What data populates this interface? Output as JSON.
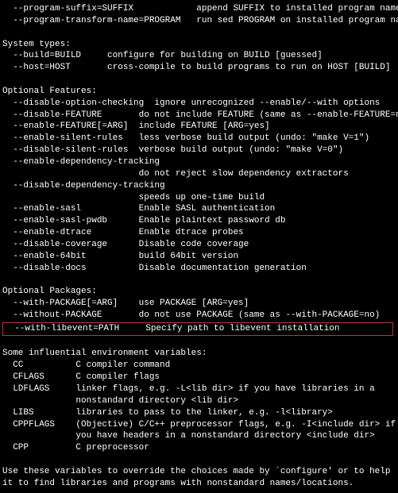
{
  "top": [
    "  --program-suffix=SUFFIX            append SUFFIX to installed program names",
    "  --program-transform-name=PROGRAM   run sed PROGRAM on installed program names"
  ],
  "system_types": {
    "header": "System types:",
    "lines": [
      "  --build=BUILD     configure for building on BUILD [guessed]",
      "  --host=HOST       cross-compile to build programs to run on HOST [BUILD]"
    ]
  },
  "optional_features": {
    "header": "Optional Features:",
    "lines": [
      "  --disable-option-checking  ignore unrecognized --enable/--with options",
      "  --disable-FEATURE       do not include FEATURE (same as --enable-FEATURE=no)",
      "  --enable-FEATURE[=ARG]  include FEATURE [ARG=yes]",
      "  --enable-silent-rules   less verbose build output (undo: \"make V=1\")",
      "  --disable-silent-rules  verbose build output (undo: \"make V=0\")",
      "  --enable-dependency-tracking",
      "                          do not reject slow dependency extractors",
      "  --disable-dependency-tracking",
      "                          speeds up one-time build",
      "  --enable-sasl           Enable SASL authentication",
      "  --enable-sasl-pwdb      Enable plaintext password db",
      "  --enable-dtrace         Enable dtrace probes",
      "  --disable-coverage      Disable code coverage",
      "  --enable-64bit          build 64bit version",
      "  --disable-docs          Disable documentation generation"
    ]
  },
  "optional_packages": {
    "header": "Optional Packages:",
    "lines": [
      "  --with-PACKAGE[=ARG]    use PACKAGE [ARG=yes]",
      "  --without-PACKAGE       do not use PACKAGE (same as --with-PACKAGE=no)"
    ],
    "highlight": "  --with-libevent=PATH     Specify path to libevent installation          "
  },
  "env": {
    "header": "Some influential environment variables:",
    "lines": [
      "  CC          C compiler command",
      "  CFLAGS      C compiler flags",
      "  LDFLAGS     linker flags, e.g. -L<lib dir> if you have libraries in a",
      "              nonstandard directory <lib dir>",
      "  LIBS        libraries to pass to the linker, e.g. -l<library>",
      "  CPPFLAGS    (Objective) C/C++ preprocessor flags, e.g. -I<include dir> if",
      "              you have headers in a nonstandard directory <include dir>",
      "  CPP         C preprocessor"
    ]
  },
  "footer": [
    "Use these variables to override the choices made by `configure' or to help",
    "it to find libraries and programs with nonstandard names/locations."
  ]
}
